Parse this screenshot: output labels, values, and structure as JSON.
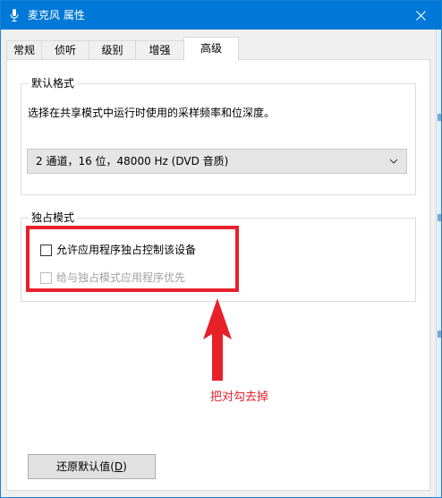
{
  "window": {
    "title": "麦克风 属性",
    "close_glyph": "✕"
  },
  "tabs": [
    {
      "label": "常规",
      "active": false
    },
    {
      "label": "侦听",
      "active": false
    },
    {
      "label": "级别",
      "active": false
    },
    {
      "label": "增强",
      "active": false
    },
    {
      "label": "高级",
      "active": true
    }
  ],
  "default_format": {
    "legend": "默认格式",
    "description": "选择在共享模式中运行时使用的采样频率和位深度。",
    "selected_value": "2 通道，16 位，48000 Hz (DVD 音质)"
  },
  "exclusive_mode": {
    "legend": "独占模式",
    "allow_exclusive": {
      "label": "允许应用程序独占控制该设备",
      "checked": false,
      "enabled": true
    },
    "give_priority": {
      "label": "给与独占模式应用程序优先",
      "checked": false,
      "enabled": false
    }
  },
  "annotation": {
    "text": "把对勾去掉",
    "color": "#e8202a"
  },
  "restore_button": {
    "label": "还原默认值",
    "mnemonic_open": "(",
    "mnemonic_key": "D",
    "mnemonic_close": ")"
  },
  "colors": {
    "titlebar": "#0078d7",
    "highlight": "#e8202a"
  },
  "icons": {
    "app": "microphone-icon",
    "close": "close-icon",
    "dropdown": "chevron-down-icon",
    "arrow": "arrow-up-icon"
  }
}
